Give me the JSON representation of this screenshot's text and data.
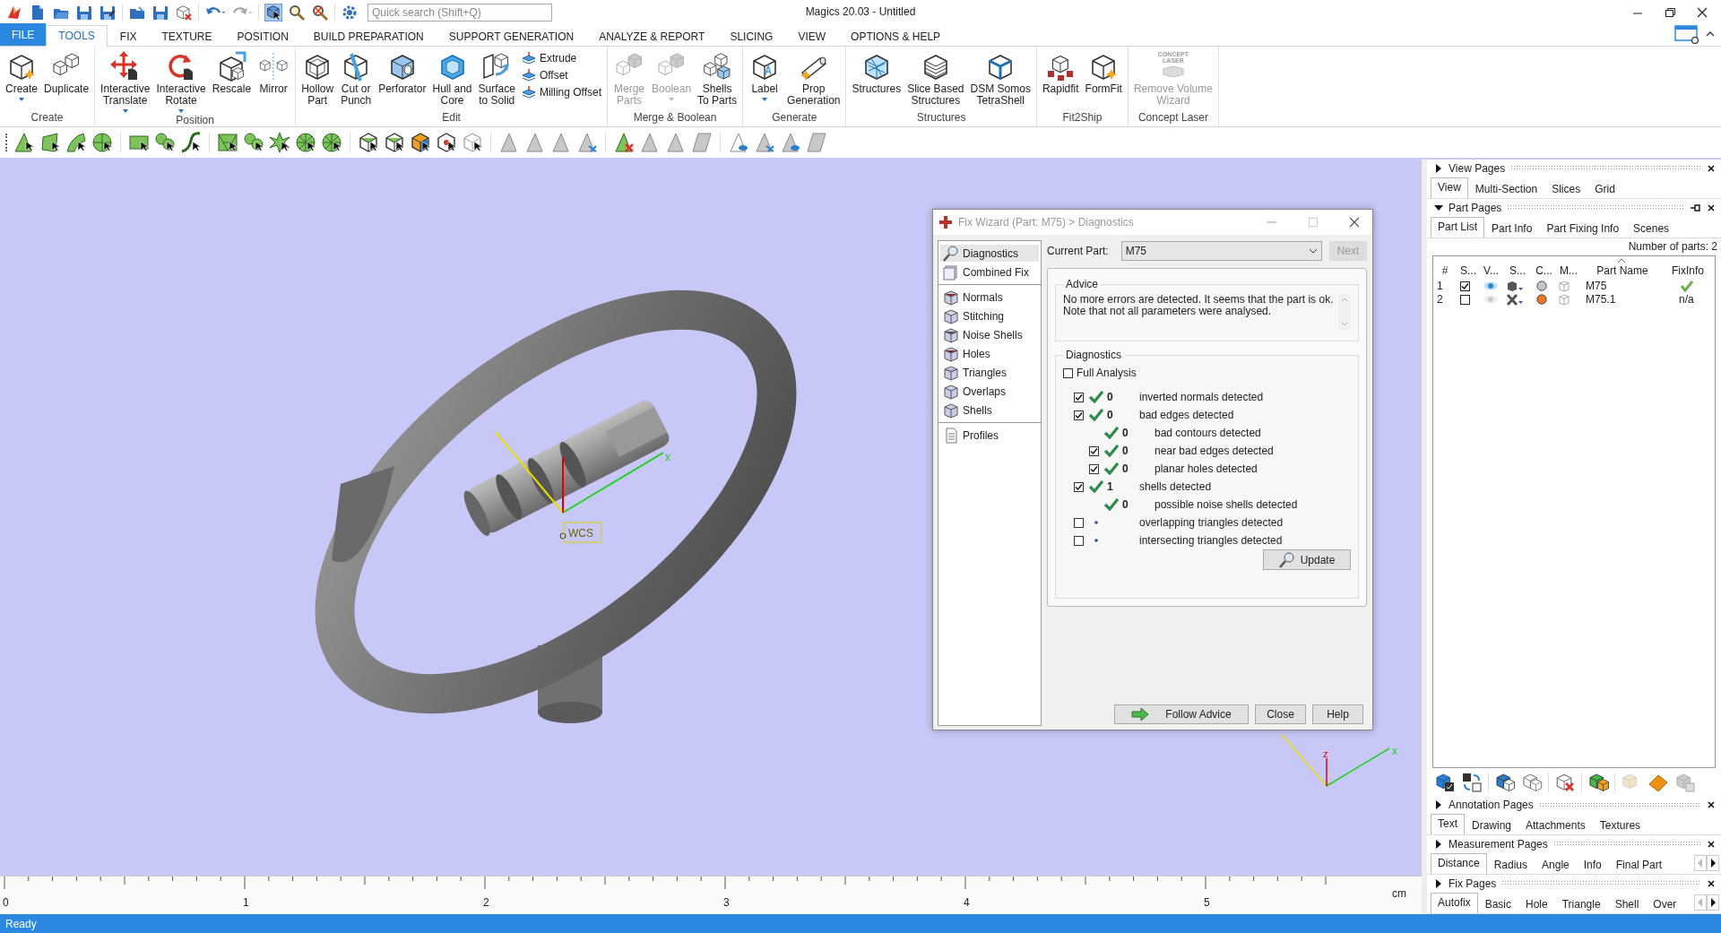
{
  "window": {
    "title": "Magics 20.03 - Untitled"
  },
  "quick_search": {
    "placeholder": "Quick search (Shift+Q)"
  },
  "ribbon_tabs": [
    {
      "label": "FILE",
      "kind": "file",
      "selected": false
    },
    {
      "label": "TOOLS",
      "kind": "tab",
      "selected": true
    },
    {
      "label": "FIX",
      "kind": "tab",
      "selected": false
    },
    {
      "label": "TEXTURE",
      "kind": "tab",
      "selected": false
    },
    {
      "label": "POSITION",
      "kind": "tab",
      "selected": false
    },
    {
      "label": "BUILD PREPARATION",
      "kind": "tab",
      "selected": false
    },
    {
      "label": "SUPPORT GENERATION",
      "kind": "tab",
      "selected": false
    },
    {
      "label": "ANALYZE & REPORT",
      "kind": "tab",
      "selected": false
    },
    {
      "label": "SLICING",
      "kind": "tab",
      "selected": false
    },
    {
      "label": "VIEW",
      "kind": "tab",
      "selected": false
    },
    {
      "label": "OPTIONS & HELP",
      "kind": "tab",
      "selected": false
    }
  ],
  "ribbon_groups": [
    {
      "label": "Create",
      "buttons": [
        {
          "label": "Create",
          "kind": "large",
          "dropdown": true,
          "disabled": false
        },
        {
          "label": "Duplicate",
          "kind": "large",
          "dropdown": false,
          "disabled": false
        }
      ]
    },
    {
      "label": "Position",
      "buttons": [
        {
          "label": "Interactive\nTranslate",
          "kind": "large",
          "dropdown": true,
          "disabled": false
        },
        {
          "label": "Interactive\nRotate",
          "kind": "large",
          "dropdown": true,
          "disabled": false
        },
        {
          "label": "Rescale",
          "kind": "large",
          "dropdown": false,
          "disabled": false
        },
        {
          "label": "Mirror",
          "kind": "large",
          "dropdown": false,
          "disabled": false
        }
      ]
    },
    {
      "label": "Edit",
      "buttons": [
        {
          "label": "Hollow\nPart",
          "kind": "large",
          "dropdown": false,
          "disabled": false
        },
        {
          "label": "Cut or\nPunch",
          "kind": "large",
          "dropdown": false,
          "disabled": false
        },
        {
          "label": "Perforator",
          "kind": "large",
          "dropdown": false,
          "disabled": false
        },
        {
          "label": "Hull and\nCore",
          "kind": "large",
          "dropdown": false,
          "disabled": false
        },
        {
          "label": "Surface\nto Solid",
          "kind": "large",
          "dropdown": false,
          "disabled": false
        },
        {
          "label": "Extrude",
          "kind": "small",
          "dropdown": false,
          "disabled": false
        },
        {
          "label": "Offset",
          "kind": "small",
          "dropdown": false,
          "disabled": false
        },
        {
          "label": "Milling Offset",
          "kind": "small",
          "dropdown": false,
          "disabled": false
        }
      ]
    },
    {
      "label": "Merge & Boolean",
      "buttons": [
        {
          "label": "Merge\nParts",
          "kind": "large",
          "dropdown": false,
          "disabled": true
        },
        {
          "label": "Boolean",
          "kind": "large",
          "dropdown": true,
          "disabled": true
        },
        {
          "label": "Shells\nTo Parts",
          "kind": "large",
          "dropdown": false,
          "disabled": false
        }
      ]
    },
    {
      "label": "Generate",
      "buttons": [
        {
          "label": "Label",
          "kind": "large",
          "dropdown": true,
          "disabled": false
        },
        {
          "label": "Prop\nGeneration",
          "kind": "large",
          "dropdown": false,
          "disabled": false
        }
      ]
    },
    {
      "label": "Structures",
      "buttons": [
        {
          "label": "Structures",
          "kind": "large",
          "dropdown": false,
          "disabled": false
        },
        {
          "label": "Slice Based\nStructures",
          "kind": "large",
          "dropdown": false,
          "disabled": false
        },
        {
          "label": "DSM Somos\nTetraShell",
          "kind": "large",
          "dropdown": false,
          "disabled": false
        }
      ]
    },
    {
      "label": "Fit2Ship",
      "buttons": [
        {
          "label": "Rapidfit",
          "kind": "large",
          "dropdown": false,
          "disabled": false
        },
        {
          "label": "FormFit",
          "kind": "large",
          "dropdown": false,
          "disabled": false
        }
      ]
    },
    {
      "label": "Concept Laser",
      "buttons": [
        {
          "label": "Remove Volume\nWizard",
          "kind": "logo",
          "logo_text": "CONCEPT\nLASER",
          "dropdown": false,
          "disabled": true
        }
      ]
    }
  ],
  "viewport": {
    "wcs": {
      "label": "WCS",
      "x_label": "x"
    },
    "view_triad": {
      "z_label": "z",
      "x_label": "x"
    },
    "ruler": {
      "ticks": [
        "0",
        "1",
        "2",
        "3",
        "4",
        "5"
      ],
      "unit": "cm"
    }
  },
  "fix_wizard": {
    "title": "Fix Wizard (Part: M75) > Diagnostics",
    "nav_groups": [
      {
        "items": [
          {
            "label": "Diagnostics",
            "selected": true
          },
          {
            "label": "Combined Fix",
            "selected": false
          }
        ]
      },
      {
        "items": [
          {
            "label": "Normals",
            "selected": false
          },
          {
            "label": "Stitching",
            "selected": false
          },
          {
            "label": "Noise Shells",
            "selected": false
          },
          {
            "label": "Holes",
            "selected": false
          },
          {
            "label": "Triangles",
            "selected": false
          },
          {
            "label": "Overlaps",
            "selected": false
          },
          {
            "label": "Shells",
            "selected": false
          }
        ]
      },
      {
        "items": [
          {
            "label": "Profiles",
            "selected": false
          }
        ]
      }
    ],
    "current_part": {
      "label": "Current Part:",
      "value": "M75"
    },
    "next_button": {
      "label": "Next",
      "disabled": true
    },
    "advice": {
      "title": "Advice",
      "text": "No more errors are detected. It seems that the part is ok.\nNote that not all parameters were analysed."
    },
    "diagnostics": {
      "title": "Diagnostics",
      "full_analysis": {
        "label": "Full Analysis",
        "checked": false
      },
      "checks": [
        {
          "kind": "checkbox",
          "checked": true,
          "analysed": true,
          "count": "0",
          "label": "inverted normals detected"
        },
        {
          "kind": "checkbox",
          "checked": true,
          "analysed": true,
          "count": "0",
          "label": "bad edges detected",
          "children": [
            {
              "kind": "plain",
              "analysed": true,
              "count": "0",
              "label": "bad contours detected"
            },
            {
              "kind": "checkbox",
              "checked": true,
              "analysed": true,
              "count": "0",
              "label": "near bad edges detected"
            },
            {
              "kind": "checkbox",
              "checked": true,
              "analysed": true,
              "count": "0",
              "label": "planar holes detected"
            }
          ]
        },
        {
          "kind": "checkbox",
          "checked": true,
          "analysed": true,
          "count": "1",
          "label": "shells detected",
          "children": [
            {
              "kind": "plain",
              "analysed": true,
              "count": "0",
              "label": "possible noise shells detected"
            }
          ]
        },
        {
          "kind": "checkbox",
          "checked": false,
          "analysed": false,
          "label": "overlapping triangles detected"
        },
        {
          "kind": "checkbox",
          "checked": false,
          "analysed": false,
          "label": "intersecting triangles detected"
        }
      ],
      "update_button": "Update"
    },
    "buttons": [
      {
        "label": "Follow Advice",
        "kind": "advice"
      },
      {
        "label": "Close",
        "kind": "plain"
      },
      {
        "label": "Help",
        "kind": "plain"
      }
    ]
  },
  "side_panel": {
    "sections": [
      {
        "kind": "tabs",
        "title": "View Pages",
        "expanded": false,
        "pinnable": false,
        "scroll_arrows": false,
        "tabs": [
          {
            "label": "View",
            "selected": true
          },
          {
            "label": "Multi-Section",
            "selected": false
          },
          {
            "label": "Slices",
            "selected": false
          },
          {
            "label": "Grid",
            "selected": false
          }
        ]
      },
      {
        "kind": "part_list",
        "title": "Part Pages",
        "expanded": true,
        "pinnable": true,
        "scroll_arrows": false,
        "tabs": [
          {
            "label": "Part List",
            "selected": true
          },
          {
            "label": "Part Info",
            "selected": false
          },
          {
            "label": "Part Fixing Info",
            "selected": false
          },
          {
            "label": "Scenes",
            "selected": false
          }
        ],
        "part_count": "Number of parts: 2",
        "columns": [
          {
            "label": "#",
            "sorted": false
          },
          {
            "label": "S...",
            "sorted": false
          },
          {
            "label": "V...",
            "sorted": false
          },
          {
            "label": "S...",
            "sorted": false
          },
          {
            "label": "C...",
            "sorted": false
          },
          {
            "label": "M...",
            "sorted": false
          },
          {
            "label": "Part Name",
            "sorted": true
          },
          {
            "label": "FixInfo",
            "sorted": false
          }
        ],
        "rows": [
          {
            "number": "1",
            "selected": true,
            "visible": true,
            "shaded": true,
            "color": "#c4c4cc",
            "name": "M75",
            "fix": {
              "kind": "ok"
            }
          },
          {
            "number": "2",
            "selected": false,
            "visible": false,
            "shaded": false,
            "color": "#e8782a",
            "name": "M75.1",
            "fix": {
              "kind": "text",
              "text": "n/a"
            }
          }
        ]
      },
      {
        "kind": "tabs",
        "title": "Annotation Pages",
        "expanded": false,
        "pinnable": false,
        "scroll_arrows": false,
        "tabs": [
          {
            "label": "Text",
            "selected": true
          },
          {
            "label": "Drawing",
            "selected": false
          },
          {
            "label": "Attachments",
            "selected": false
          },
          {
            "label": "Textures",
            "selected": false
          }
        ]
      },
      {
        "kind": "tabs",
        "title": "Measurement Pages",
        "expanded": false,
        "pinnable": false,
        "scroll_arrows": true,
        "tabs": [
          {
            "label": "Distance",
            "selected": true
          },
          {
            "label": "Radius",
            "selected": false
          },
          {
            "label": "Angle",
            "selected": false
          },
          {
            "label": "Info",
            "selected": false
          },
          {
            "label": "Final Part",
            "selected": false
          }
        ]
      },
      {
        "kind": "tabs",
        "title": "Fix Pages",
        "expanded": false,
        "pinnable": false,
        "scroll_arrows": true,
        "tabs": [
          {
            "label": "Autofix",
            "selected": true
          },
          {
            "label": "Basic",
            "selected": false
          },
          {
            "label": "Hole",
            "selected": false
          },
          {
            "label": "Triangle",
            "selected": false
          },
          {
            "label": "Shell",
            "selected": false
          },
          {
            "label": "Over",
            "selected": false
          }
        ]
      }
    ]
  },
  "status_bar": {
    "text": "Ready"
  }
}
